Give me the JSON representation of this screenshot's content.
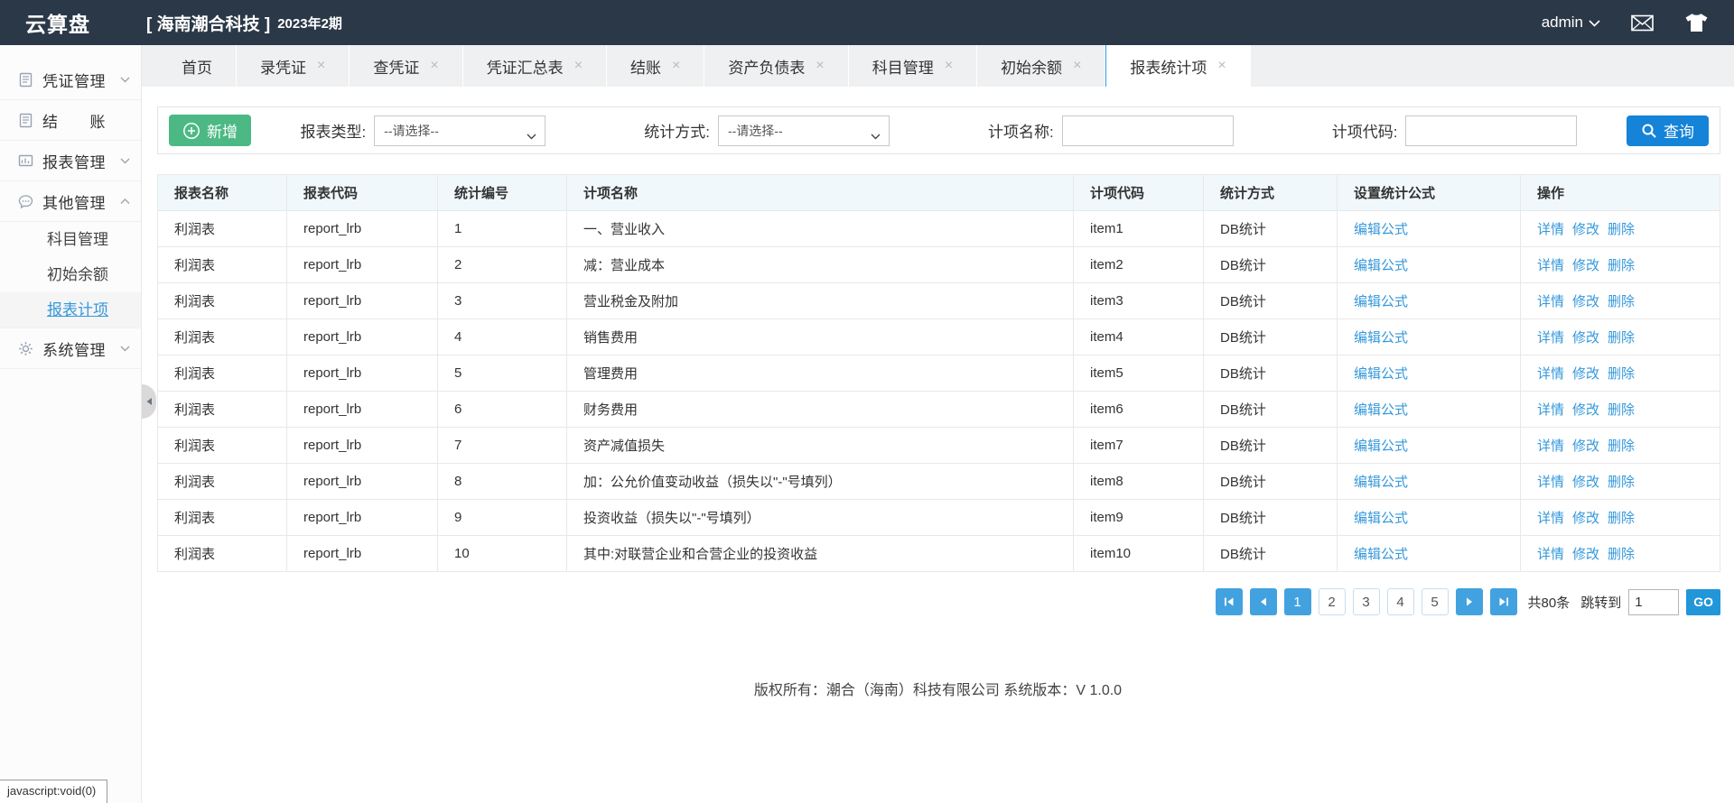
{
  "topbar": {
    "logo": "云算盘",
    "company_tag": "[ 海南潮合科技 ]",
    "period": "2023年2期",
    "user": "admin"
  },
  "sidebar": {
    "items": [
      {
        "name": "voucher-management",
        "label": "凭证管理",
        "icon": "doc",
        "expandable": true,
        "expanded": false
      },
      {
        "name": "closing",
        "label": "结　　账",
        "icon": "doc",
        "expandable": false
      },
      {
        "name": "report-management",
        "label": "报表管理",
        "icon": "report",
        "expandable": true,
        "expanded": false
      },
      {
        "name": "other-management",
        "label": "其他管理",
        "icon": "chat",
        "expandable": true,
        "expanded": true,
        "children": [
          {
            "name": "subject-management",
            "label": "科目管理",
            "active": false
          },
          {
            "name": "initial-balance",
            "label": "初始余额",
            "active": false
          },
          {
            "name": "report-items",
            "label": "报表计项",
            "active": true
          }
        ]
      },
      {
        "name": "system-management",
        "label": "系统管理",
        "icon": "gear",
        "expandable": true,
        "expanded": false
      }
    ]
  },
  "tabs": [
    {
      "name": "home",
      "label": "首页",
      "closable": false,
      "active": false
    },
    {
      "name": "voucher-entry",
      "label": "录凭证",
      "closable": true,
      "active": false
    },
    {
      "name": "voucher-query",
      "label": "查凭证",
      "closable": true,
      "active": false
    },
    {
      "name": "voucher-summary",
      "label": "凭证汇总表",
      "closable": true,
      "active": false
    },
    {
      "name": "closing",
      "label": "结账",
      "closable": true,
      "active": false
    },
    {
      "name": "balance-sheet",
      "label": "资产负债表",
      "closable": true,
      "active": false
    },
    {
      "name": "subject-management",
      "label": "科目管理",
      "closable": true,
      "active": false
    },
    {
      "name": "initial-balance",
      "label": "初始余额",
      "closable": true,
      "active": false
    },
    {
      "name": "report-stat-items",
      "label": "报表统计项",
      "closable": true,
      "active": true
    }
  ],
  "toolbar": {
    "add_label": "新增",
    "filters": [
      {
        "name": "report-type",
        "label": "报表类型:",
        "type": "select",
        "value": "--请选择--"
      },
      {
        "name": "stat-method",
        "label": "统计方式:",
        "type": "select",
        "value": "--请选择--"
      },
      {
        "name": "item-name",
        "label": "计项名称:",
        "type": "input",
        "value": ""
      },
      {
        "name": "item-code",
        "label": "计项代码:",
        "type": "input",
        "value": ""
      }
    ],
    "search_label": "查询"
  },
  "table": {
    "columns": [
      "报表名称",
      "报表代码",
      "统计编号",
      "计项名称",
      "计项代码",
      "统计方式",
      "设置统计公式",
      "操作"
    ],
    "formula_link": "编辑公式",
    "action_links": [
      "详情",
      "修改",
      "删除"
    ],
    "rows": [
      {
        "report_name": "利润表",
        "report_code": "report_lrb",
        "stat_no": "1",
        "item_name": "一、营业收入",
        "item_code": "item1",
        "stat_method": "DB统计"
      },
      {
        "report_name": "利润表",
        "report_code": "report_lrb",
        "stat_no": "2",
        "item_name": "减：营业成本",
        "item_code": "item2",
        "stat_method": "DB统计"
      },
      {
        "report_name": "利润表",
        "report_code": "report_lrb",
        "stat_no": "3",
        "item_name": "营业税金及附加",
        "item_code": "item3",
        "stat_method": "DB统计"
      },
      {
        "report_name": "利润表",
        "report_code": "report_lrb",
        "stat_no": "4",
        "item_name": "销售费用",
        "item_code": "item4",
        "stat_method": "DB统计"
      },
      {
        "report_name": "利润表",
        "report_code": "report_lrb",
        "stat_no": "5",
        "item_name": "管理费用",
        "item_code": "item5",
        "stat_method": "DB统计"
      },
      {
        "report_name": "利润表",
        "report_code": "report_lrb",
        "stat_no": "6",
        "item_name": "财务费用",
        "item_code": "item6",
        "stat_method": "DB统计"
      },
      {
        "report_name": "利润表",
        "report_code": "report_lrb",
        "stat_no": "7",
        "item_name": "资产减值损失",
        "item_code": "item7",
        "stat_method": "DB统计"
      },
      {
        "report_name": "利润表",
        "report_code": "report_lrb",
        "stat_no": "8",
        "item_name": "加：公允价值变动收益（损失以\"-\"号填列）",
        "item_code": "item8",
        "stat_method": "DB统计"
      },
      {
        "report_name": "利润表",
        "report_code": "report_lrb",
        "stat_no": "9",
        "item_name": "投资收益（损失以\"-\"号填列）",
        "item_code": "item9",
        "stat_method": "DB统计"
      },
      {
        "report_name": "利润表",
        "report_code": "report_lrb",
        "stat_no": "10",
        "item_name": "其中:对联营企业和合营企业的投资收益",
        "item_code": "item10",
        "stat_method": "DB统计"
      }
    ]
  },
  "pagination": {
    "pages": [
      "1",
      "2",
      "3",
      "4",
      "5"
    ],
    "current": "1",
    "total_text": "共80条",
    "jump_label": "跳转到",
    "jump_value": "1",
    "go_label": "GO"
  },
  "footer": {
    "text": "版权所有：潮合（海南）科技有限公司 系统版本：V 1.0.0"
  },
  "statusbar": {
    "text": "javascript:void(0)"
  },
  "colors": {
    "topbar": "#2b3848",
    "accent": "#3598db",
    "green": "#4cb984",
    "query_blue": "#1583d7",
    "table_header_bg": "#f0f8fc"
  }
}
